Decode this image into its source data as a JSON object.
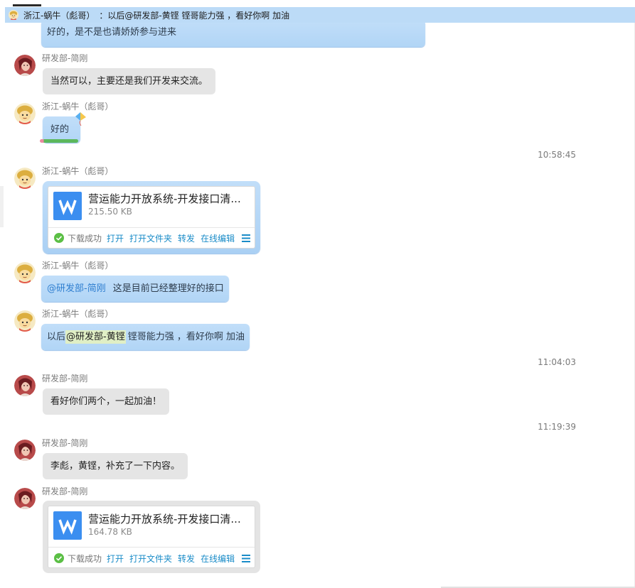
{
  "banner": {
    "sender": "浙江-蜗牛（彪哥）",
    "message": "：以后@研发部-黄铿 铿哥能力强 ，看好你啊 加油"
  },
  "conversation": [
    {
      "text": "好的，是不是也请娇娇参与进来"
    },
    {
      "sender": "研发部-简刚",
      "text": "当然可以，主要还是我们开发来交流。"
    },
    {
      "sender": "浙江-蜗牛（彪哥）",
      "text": "好的"
    },
    {
      "time": "10:58:45"
    },
    {
      "sender": "浙江-蜗牛（彪哥）",
      "file": {
        "icon": "word-file-icon",
        "name": "营运能力开放系统-开发接口清...",
        "size": "215.50 KB",
        "status": "下载成功",
        "actions": [
          "打开",
          "打开文件夹",
          "转发",
          "在线编辑"
        ]
      }
    },
    {
      "sender": "浙江-蜗牛（彪哥）",
      "mention": "@研发部-简刚",
      "text": "这是目前已经整理好的接口"
    },
    {
      "sender": "浙江-蜗牛（彪哥）",
      "prefix": "以后",
      "mention": "@研发部-黄铿",
      "text": "铿哥能力强 ，看好你啊 加油"
    },
    {
      "time": "11:04:03"
    },
    {
      "sender": "研发部-简刚",
      "text": "看好你们两个，一起加油！"
    },
    {
      "time": "11:19:39"
    },
    {
      "sender": "研发部-简刚",
      "text": "李彪，黄铿，补充了一下内容。"
    },
    {
      "sender": "研发部-简刚",
      "file": {
        "icon": "word-file-icon",
        "name": "营运能力开放系统-开发接口清...",
        "size": "164.78 KB",
        "status": "下载成功",
        "actions": [
          "打开",
          "打开文件夹",
          "转发",
          "在线编辑"
        ]
      }
    }
  ],
  "colors": {
    "banner": "#bcdbf7",
    "blue_bubble": "#b8d9f8",
    "gray_bubble": "#e5e5e5",
    "link": "#1a8cc8",
    "mention": "#2f7fd0",
    "mention_highlight": "#e0efc5",
    "success": "#5bbf45",
    "word_icon": "#3b8ef0"
  }
}
